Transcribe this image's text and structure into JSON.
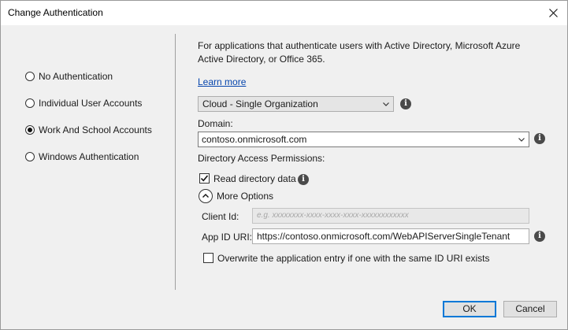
{
  "window": {
    "title": "Change Authentication",
    "close_icon": "close-icon"
  },
  "auth_options": [
    {
      "label": "No Authentication",
      "checked": false
    },
    {
      "label": "Individual User Accounts",
      "checked": false
    },
    {
      "label": "Work And School Accounts",
      "checked": true
    },
    {
      "label": "Windows Authentication",
      "checked": false
    }
  ],
  "description": "For applications that authenticate users with Active Directory, Microsoft Azure Active Directory, or Office 365.",
  "learn_more": "Learn more",
  "org_type": {
    "selected": "Cloud - Single Organization"
  },
  "domain": {
    "label": "Domain:",
    "value": "contoso.onmicrosoft.com"
  },
  "permissions": {
    "label": "Directory Access Permissions:",
    "read_directory": {
      "label": "Read directory data",
      "checked": true
    }
  },
  "more_options": {
    "label": "More Options",
    "client_id": {
      "label": "Client Id:",
      "placeholder": "e.g. xxxxxxxx-xxxx-xxxx-xxxx-xxxxxxxxxxxx"
    },
    "app_id_uri": {
      "label": "App ID URI:",
      "value": "https://contoso.onmicrosoft.com/WebAPIServerSingleTenant"
    },
    "overwrite": {
      "label": "Overwrite the application entry if one with the same ID URI exists",
      "checked": false
    }
  },
  "buttons": {
    "ok": "OK",
    "cancel": "Cancel"
  },
  "colors": {
    "link": "#0645ad",
    "default_button_border": "#0078d7"
  }
}
